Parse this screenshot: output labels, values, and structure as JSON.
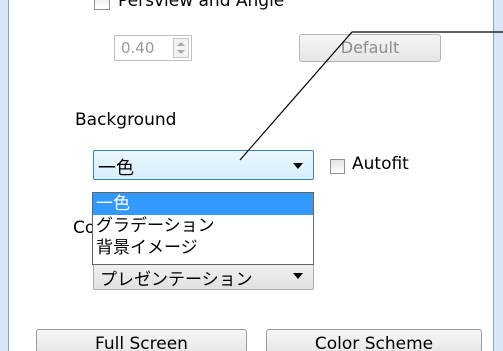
{
  "top_option": {
    "label": "Persview and Angle"
  },
  "spinner": {
    "value": "0.40"
  },
  "default_button": {
    "label": "Default"
  },
  "background": {
    "label": "Background",
    "selected_value": "一色",
    "options": [
      "一色",
      "グラデーション",
      "背景イメージ"
    ],
    "selected_index": 0
  },
  "autofit": {
    "label": "Autofit",
    "checked": false
  },
  "color": {
    "label": "Co",
    "selected_value": "プレゼンテーション"
  },
  "bottom_buttons": {
    "left_label": "Full Screen",
    "right_label": "Color Scheme"
  },
  "colors": {
    "accent": "#3399ff",
    "frame": "#d8e6f6"
  },
  "icons": {
    "combo_arrow": "chevron-down-icon",
    "spin_up": "arrow-up-icon",
    "spin_down": "arrow-down-icon"
  }
}
